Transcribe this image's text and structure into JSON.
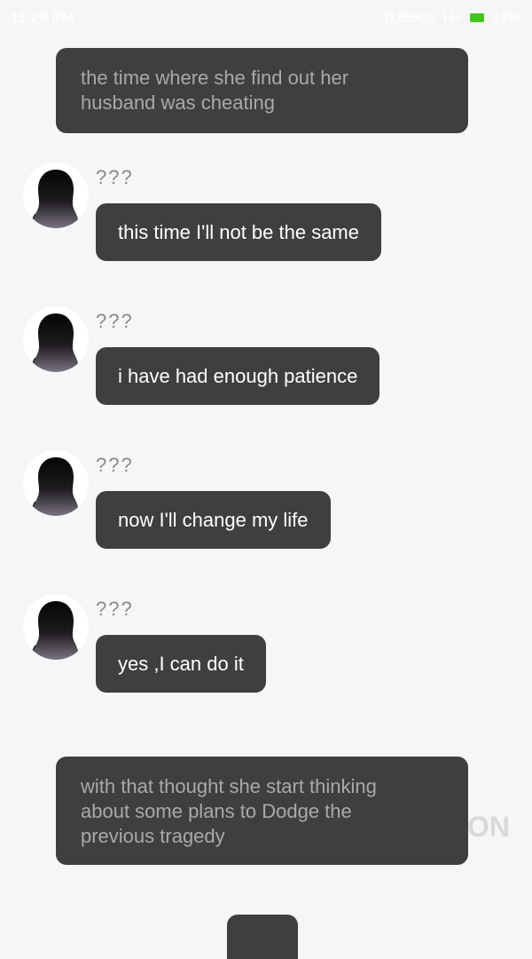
{
  "status_bar": {
    "time": "11:29 PM",
    "speed": "0.85K/s",
    "network": "H+",
    "battery": "43%",
    "colors": {
      "battery": "#45c61d"
    }
  },
  "narrations": [
    {
      "lines": [
        "the time where she find out her",
        "husband was cheating"
      ]
    },
    {
      "lines": [
        "with that thought she start thinking",
        "about some plans to Dodge the",
        "previous tragedy"
      ]
    }
  ],
  "messages": [
    {
      "sender": "???",
      "text": "this time I'll not be the same"
    },
    {
      "sender": "???",
      "text": "i have had enough patience"
    },
    {
      "sender": "???",
      "text": "now I'll change my life"
    },
    {
      "sender": "???",
      "text": "yes ,I can do it"
    }
  ],
  "watermark": "ON",
  "colors": {
    "background": "#f5f6f8",
    "bubble": "#3f3f3f",
    "narration_text": "#a9a9a9",
    "message_text": "#ffffff",
    "sender_text": "#8a8a8a"
  }
}
